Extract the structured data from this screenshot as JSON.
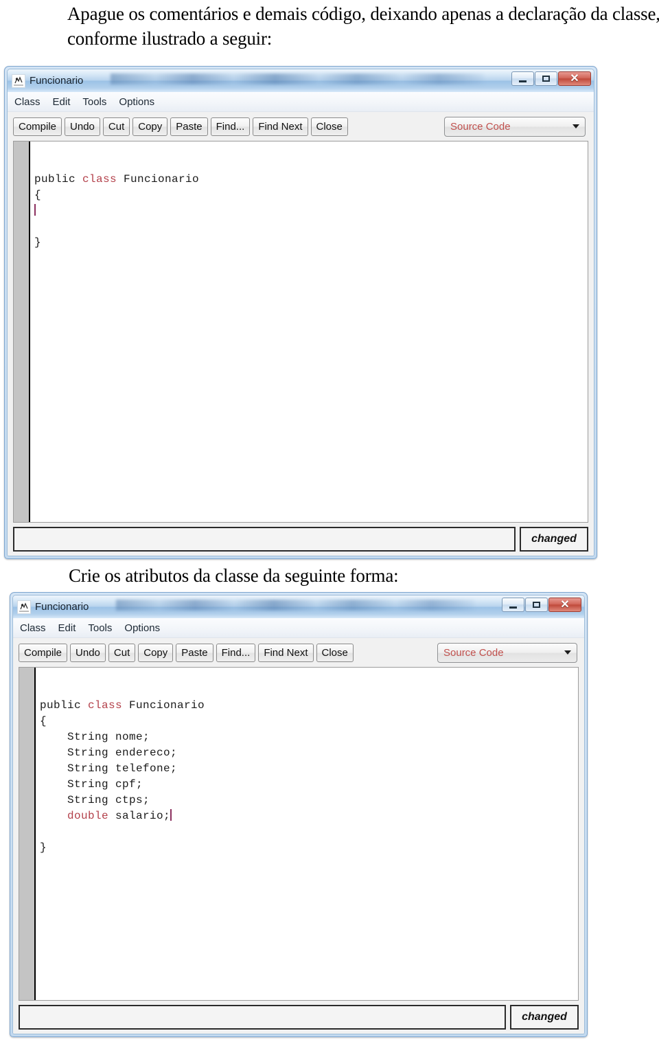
{
  "document": {
    "intro_text": "Apague os comentários e demais código, deixando apenas a declaração da classe, conforme ilustrado a seguir:",
    "middle_text": "Crie os atributos da classe da seguinte forma:"
  },
  "window_one": {
    "title": "Funcionario",
    "icon": "bluej-class-icon",
    "window_buttons": {
      "minimize": "minimize-icon",
      "maximize": "maximize-icon",
      "close": "✕"
    },
    "menu": [
      "Class",
      "Edit",
      "Tools",
      "Options"
    ],
    "toolbar_buttons": [
      "Compile",
      "Undo",
      "Cut",
      "Copy",
      "Paste",
      "Find...",
      "Find Next",
      "Close"
    ],
    "view_selector": {
      "value": "Source Code",
      "arrow": "chevron-down-icon",
      "color": "#c0504d"
    },
    "code_lines": [
      [
        {
          "t": "public ",
          "k": false
        },
        {
          "t": "class ",
          "k": true
        },
        {
          "t": "Funcionario",
          "k": false
        }
      ],
      [
        {
          "t": "{",
          "k": false
        }
      ],
      [
        {
          "t": "",
          "k": false,
          "caret": true
        }
      ],
      [
        {
          "t": "",
          "k": false
        }
      ],
      [
        {
          "t": "}",
          "k": false
        }
      ]
    ],
    "status": {
      "message": "",
      "changed_label": "changed"
    }
  },
  "window_two": {
    "title": "Funcionario",
    "icon": "bluej-class-icon",
    "window_buttons": {
      "minimize": "minimize-icon",
      "maximize": "maximize-icon",
      "close": "✕"
    },
    "menu": [
      "Class",
      "Edit",
      "Tools",
      "Options"
    ],
    "toolbar_buttons": [
      "Compile",
      "Undo",
      "Cut",
      "Copy",
      "Paste",
      "Find...",
      "Find Next",
      "Close"
    ],
    "view_selector": {
      "value": "Source Code",
      "arrow": "chevron-down-icon",
      "color": "#c0504d"
    },
    "code_lines": [
      [
        {
          "t": "public ",
          "k": false
        },
        {
          "t": "class ",
          "k": true
        },
        {
          "t": "Funcionario",
          "k": false
        }
      ],
      [
        {
          "t": "{",
          "k": false
        }
      ],
      [
        {
          "t": "    String nome;",
          "k": false
        }
      ],
      [
        {
          "t": "    String endereco;",
          "k": false
        }
      ],
      [
        {
          "t": "    String telefone;",
          "k": false
        }
      ],
      [
        {
          "t": "    String cpf;",
          "k": false
        }
      ],
      [
        {
          "t": "    String ctps;",
          "k": false
        }
      ],
      [
        {
          "t": "    ",
          "k": false
        },
        {
          "t": "double",
          "k": true
        },
        {
          "t": " salario;",
          "k": false,
          "caret": true
        }
      ],
      [
        {
          "t": "",
          "k": false
        }
      ],
      [
        {
          "t": "}",
          "k": false
        }
      ]
    ],
    "status": {
      "message": "",
      "changed_label": "changed"
    }
  }
}
